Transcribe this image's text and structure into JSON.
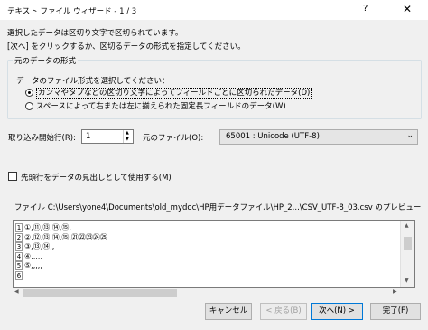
{
  "window": {
    "title": "テキスト ファイル ウィザード - 1 / 3",
    "help_glyph": "?",
    "close_glyph": "✕"
  },
  "intro": {
    "line1": "選択したデータは区切り文字で区切られています。",
    "line2": "[次へ] をクリックするか、区切るデータの形式を指定してください。"
  },
  "original_format": {
    "group_label": "元のデータの形式",
    "prompt": "データのファイル形式を選択してください：",
    "options": [
      {
        "label": "カンマやタブなどの区切り文字によってフィールドごとに区切られたデータ(D)",
        "selected": true
      },
      {
        "label": "スペースによって右または左に揃えられた固定長フィールドのデータ(W)",
        "selected": false
      }
    ]
  },
  "start_row": {
    "label": "取り込み開始行(R):",
    "value": "1"
  },
  "file_origin": {
    "label": "元のファイル(O):",
    "value": "65001 : Unicode (UTF-8)"
  },
  "header_checkbox": {
    "label": "先頭行をデータの見出しとして使用する(M)",
    "checked": false
  },
  "preview": {
    "caption": "ファイル C:\\Users\\yone4\\Documents\\old_mydoc\\HP用データファイル\\HP_2...\\CSV_UTF-8_03.csv のプレビュー",
    "rows": [
      {
        "num": "1",
        "text": "①,⑪,⑬,⑭,⑮,"
      },
      {
        "num": "2",
        "text": "②,⑫,⑬,⑭,⑮,㉑㉒㉓㉔㉕"
      },
      {
        "num": "3",
        "text": "③,⑬,⑭,,"
      },
      {
        "num": "4",
        "text": "④,,,,,"
      },
      {
        "num": "5",
        "text": "⑤,,,,,"
      },
      {
        "num": "6",
        "text": ""
      }
    ]
  },
  "buttons": {
    "cancel": "キャンセル",
    "back": "< 戻る(B)",
    "next": "次へ(N) >",
    "finish": "完了(F)"
  },
  "icons": {
    "spin_up": "spin-up-icon",
    "spin_down": "spin-down-icon",
    "dropdown": "chevron-down-icon"
  }
}
